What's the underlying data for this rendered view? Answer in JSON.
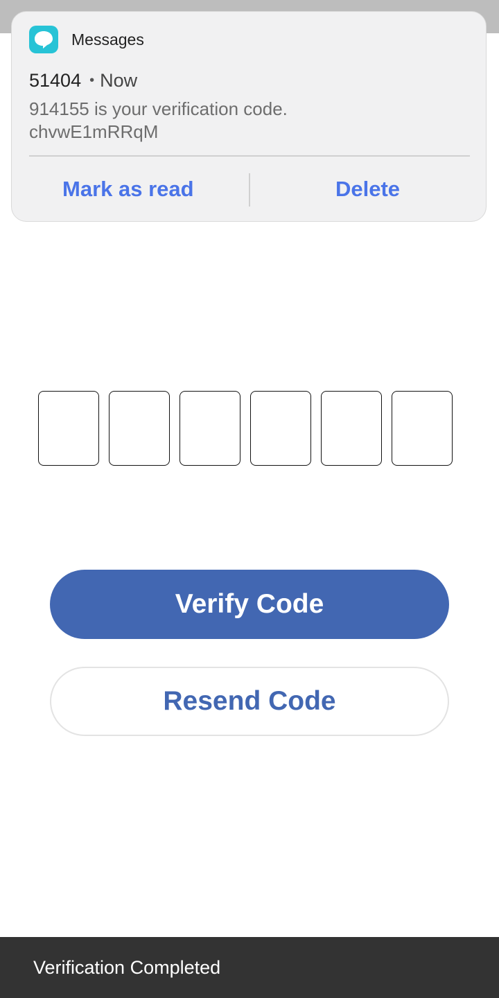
{
  "notification": {
    "app_name": "Messages",
    "app_icon": "chat-bubble-icon",
    "sender": "51404",
    "time": "Now",
    "body_line1": "914155 is your verification code.",
    "body_line2": "chvwE1mRRqM",
    "actions": {
      "mark_read": "Mark as read",
      "delete": "Delete"
    }
  },
  "code_input": {
    "digits": [
      "",
      "",
      "",
      "",
      "",
      ""
    ]
  },
  "buttons": {
    "verify": "Verify Code",
    "resend": "Resend Code"
  },
  "toast": {
    "message": "Verification Completed"
  },
  "colors": {
    "primary": "#4267b2",
    "notification_action": "#4a74e8",
    "app_icon": "#27c3d6",
    "toast_bg": "#333333"
  }
}
